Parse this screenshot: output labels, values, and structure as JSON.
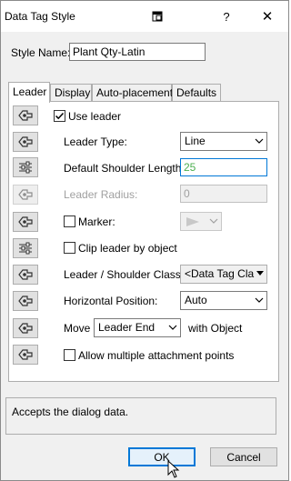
{
  "window": {
    "title": "Data Tag Style",
    "help_label": "?",
    "close_label": "✕"
  },
  "style_name": {
    "label": "Style Name:",
    "value": "Plant Qty-Latin"
  },
  "tabs": [
    {
      "label": "Leader"
    },
    {
      "label": "Display"
    },
    {
      "label": "Auto-placement"
    },
    {
      "label": "Defaults"
    }
  ],
  "leader": {
    "use_leader_label": "Use leader",
    "leader_type_label": "Leader Type:",
    "leader_type_value": "Line",
    "shoulder_length_label": "Default Shoulder Length:",
    "shoulder_length_value": "25",
    "radius_label": "Leader Radius:",
    "radius_value": "0",
    "marker_label": "Marker:",
    "clip_label": "Clip leader by object",
    "class_label": "Leader / Shoulder Class:",
    "class_value": "<Data Tag Cla",
    "hpos_label": "Horizontal Position:",
    "hpos_value": "Auto",
    "move_label": "Move",
    "move_value": "Leader End",
    "with_object_label": "with Object",
    "multi_attach_label": "Allow multiple attachment points"
  },
  "status_text": "Accepts the dialog data.",
  "buttons": {
    "ok": "OK",
    "cancel": "Cancel"
  },
  "colors": {
    "accent": "#0078d7",
    "disabled_text": "#a0a0a0",
    "shoulder_value_text": "#4caf50"
  }
}
